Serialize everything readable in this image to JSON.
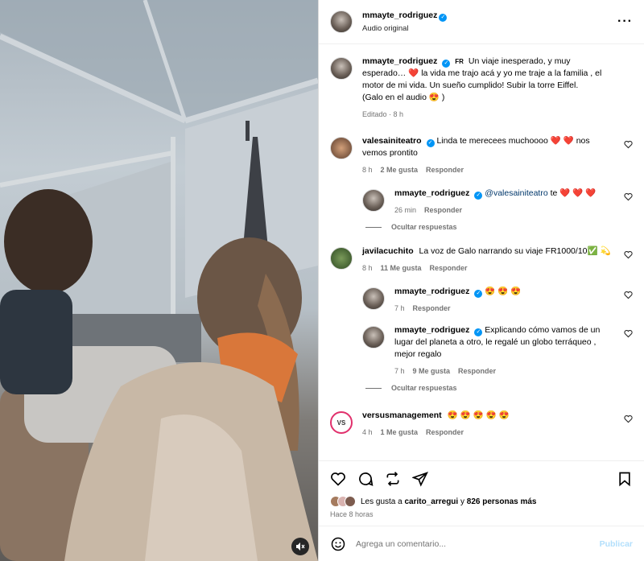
{
  "post": {
    "author": "mmayte_rodriguez",
    "audio": "Audio original",
    "caption_user": "mmayte_rodriguez",
    "caption_lang": "FR",
    "caption_text": "Un viaje inesperado, y muy esperado… ❤️ la vida me trajo acá y yo me traje a la familia , el motor de mi vida. Un sueño cumplido! Subir la torre Eiffel.",
    "caption_text2": "(Galo en el audio 😍 )",
    "caption_meta": "Editado · 8 h"
  },
  "comments": [
    {
      "user": "valesainiteatro",
      "text": "Linda te merecees muchoooo ❤️ ❤️ nos vemos prontito",
      "time": "8 h",
      "likes": "2 Me gusta",
      "reply": "Responder"
    },
    {
      "user": "mmayte_rodriguez",
      "mention": "@valesainiteatro",
      "text": "te ❤️ ❤️ ❤️",
      "time": "26 min",
      "reply": "Responder"
    },
    {
      "user": "javilacuchito",
      "text": "La voz de Galo narrando su viaje FR1000/10✅ 💫",
      "time": "8 h",
      "likes": "11 Me gusta",
      "reply": "Responder"
    },
    {
      "user": "mmayte_rodriguez",
      "text": "😍 😍 😍",
      "time": "7 h",
      "reply": "Responder"
    },
    {
      "user": "mmayte_rodriguez",
      "text": "Explicando cómo vamos de un lugar del planeta a otro, le regalé un globo terráqueo , mejor regalo",
      "time": "7 h",
      "likes": "9 Me gusta",
      "reply": "Responder"
    },
    {
      "user": "versusmanagement",
      "text": "😍 😍 😍 😍 😍",
      "time": "4 h",
      "likes": "1 Me gusta",
      "reply": "Responder"
    }
  ],
  "hide_replies": "Ocultar respuestas",
  "likes_line": {
    "prefix": "Les gusta a",
    "user": "carito_arregui",
    "mid": "y",
    "rest": "826 personas más"
  },
  "posted_ago": "Hace 8 horas",
  "add_comment": {
    "placeholder": "Agrega un comentario...",
    "publish": "Publicar"
  },
  "colors": {
    "verified": "#0095f6",
    "heart": "#e0245e",
    "muted": "#737373"
  }
}
